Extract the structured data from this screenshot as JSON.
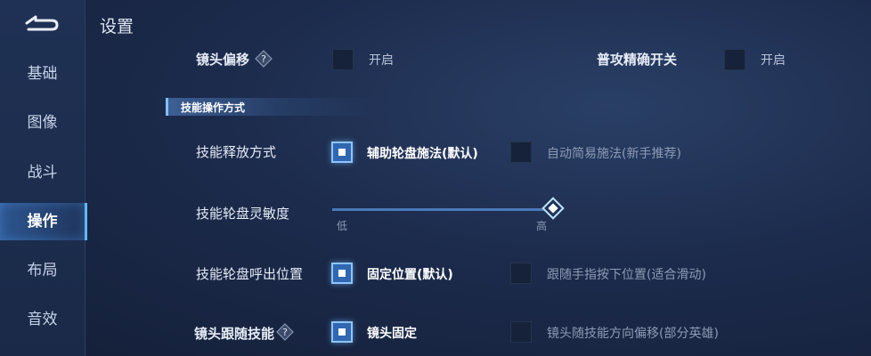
{
  "sidebar": {
    "items": [
      {
        "label": "基础"
      },
      {
        "label": "图像"
      },
      {
        "label": "战斗"
      },
      {
        "label": "操作"
      },
      {
        "label": "布局"
      },
      {
        "label": "音效"
      }
    ],
    "active_index": 3
  },
  "page_title": "设置",
  "camera_offset": {
    "label": "镜头偏移",
    "toggle_label": "开启",
    "checked": false
  },
  "precise_attack": {
    "label": "普攻精确开关",
    "toggle_label": "开启",
    "checked": false
  },
  "section_title": "技能操作方式",
  "release_mode": {
    "label": "技能释放方式",
    "options": [
      {
        "label": "辅助轮盘施法(默认)",
        "checked": true
      },
      {
        "label": "自动简易施法(新手推荐)",
        "checked": false
      }
    ]
  },
  "sensitivity": {
    "label": "技能轮盘灵敏度",
    "min_label": "低",
    "max_label": "高",
    "value": 1.0
  },
  "wheel_position": {
    "label": "技能轮盘呼出位置",
    "options": [
      {
        "label": "固定位置(默认)",
        "checked": true
      },
      {
        "label": "跟随手指按下位置(适合滑动)",
        "checked": false
      }
    ]
  },
  "camera_follow": {
    "label": "镜头跟随技能",
    "options": [
      {
        "label": "镜头固定",
        "checked": true
      },
      {
        "label": "镜头随技能方向偏移(部分英雄)",
        "checked": false
      }
    ]
  },
  "colors": {
    "accent": "#5fb8ff",
    "checkbox_on": "#2f67b0",
    "background": "#1c2b4c"
  }
}
